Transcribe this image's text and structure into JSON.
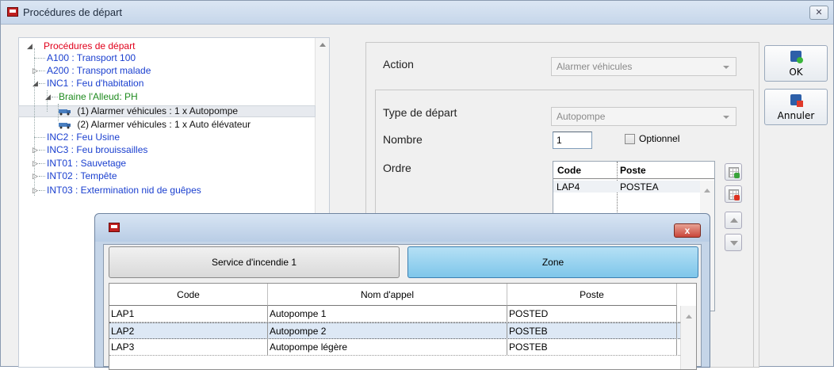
{
  "window": {
    "title": "Procédures de départ",
    "close": "✕"
  },
  "tree": {
    "root": "Procédures de départ",
    "items": [
      {
        "label": "A100 : Transport 100"
      },
      {
        "label": "A200 : Transport malade"
      },
      {
        "label": "INC1 : Feu d'habitation"
      },
      {
        "label": "Braine l'Alleud: PH"
      },
      {
        "label": "(1) Alarmer véhicules : 1 x Autopompe"
      },
      {
        "label": "(2) Alarmer véhicules : 1 x Auto élévateur"
      },
      {
        "label": "INC2 : Feu  Usine"
      },
      {
        "label": "INC3 : Feu brouissailles"
      },
      {
        "label": "INT01 : Sauvetage"
      },
      {
        "label": "INT02 : Tempête"
      },
      {
        "label": "INT03 : Extermination nid de guêpes"
      }
    ]
  },
  "form": {
    "action_label": "Action",
    "action_value": "Alarmer véhicules",
    "type_label": "Type de départ",
    "type_value": "Autopompe",
    "nombre_label": "Nombre",
    "nombre_value": "1",
    "optionnel_label": "Optionnel",
    "ordre_label": "Ordre",
    "ordre_grid": {
      "headers": [
        "Code",
        "Poste"
      ],
      "rows": [
        {
          "code": "LAP4",
          "poste": "POSTEA"
        }
      ]
    }
  },
  "buttons": {
    "ok": "OK",
    "cancel": "Annuler"
  },
  "dialog": {
    "close": "x",
    "tab_service": "Service d'incendie 1",
    "tab_zone": "Zone",
    "columns": [
      "Code",
      "Nom d'appel",
      "Poste"
    ],
    "rows": [
      {
        "code": "LAP1",
        "nom": "Autopompe 1",
        "poste": "POSTED"
      },
      {
        "code": "LAP2",
        "nom": "Autopompe 2",
        "poste": "POSTEB"
      },
      {
        "code": "LAP3",
        "nom": "Autopompe légère",
        "poste": "POSTEB"
      }
    ]
  }
}
